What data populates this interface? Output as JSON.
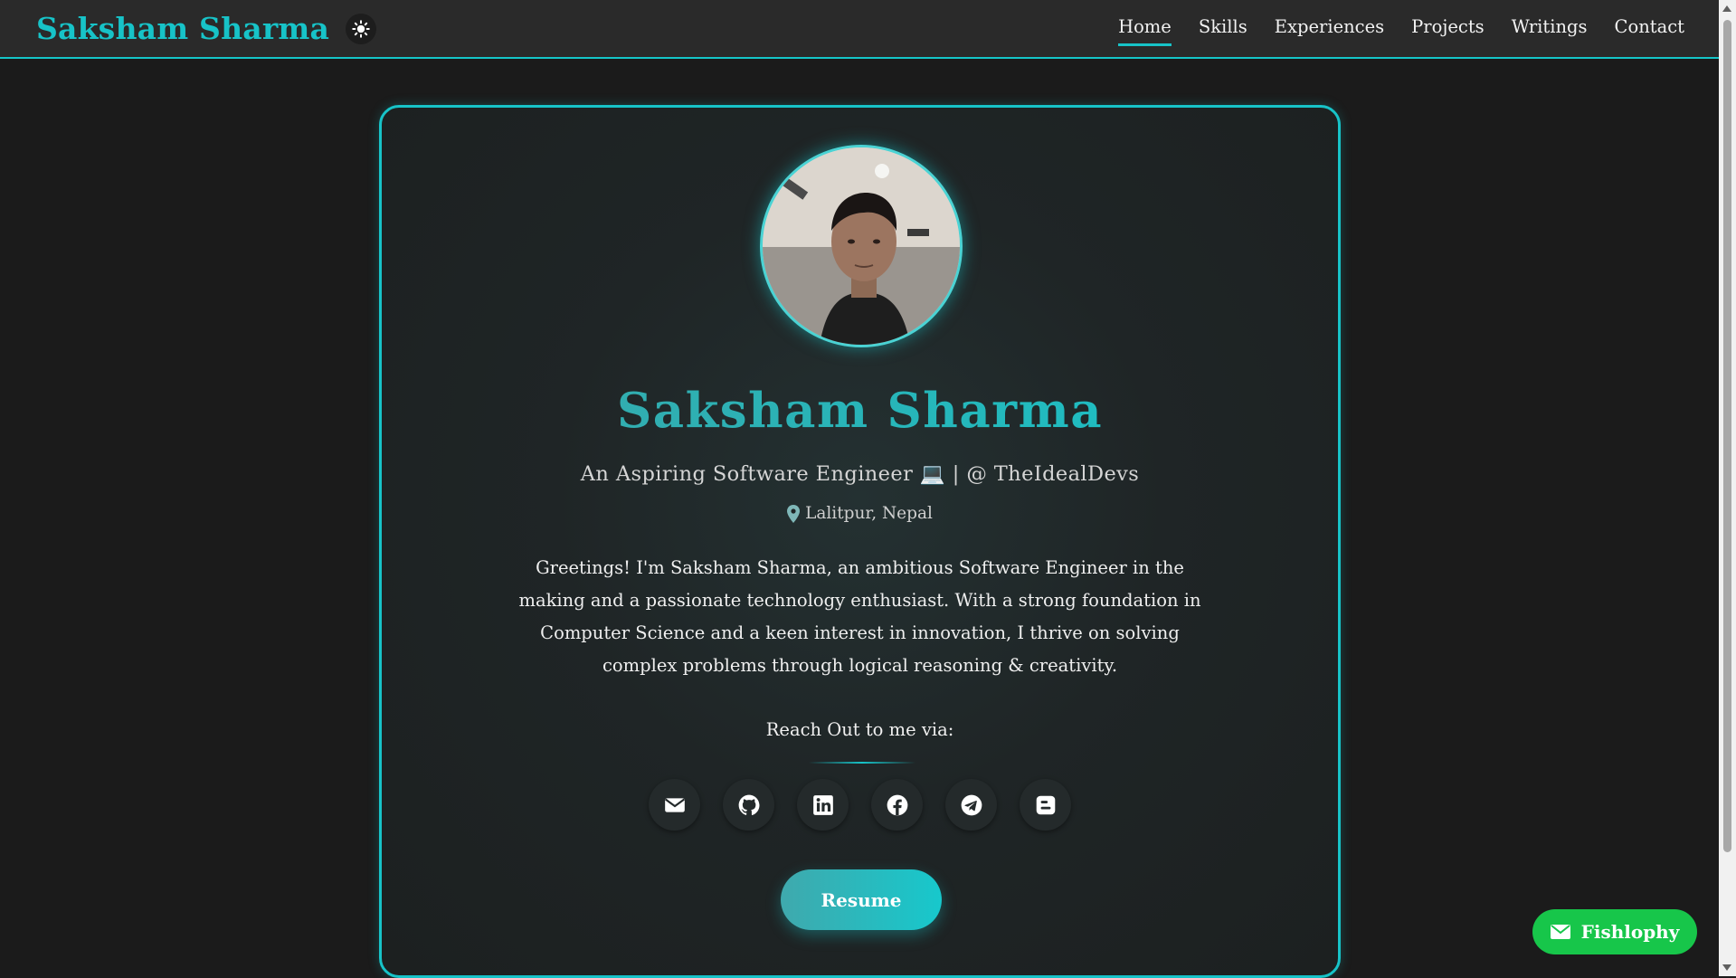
{
  "header": {
    "brand": "Saksham Sharma",
    "theme_icon": "sun-icon",
    "nav": [
      {
        "label": "Home",
        "active": true
      },
      {
        "label": "Skills",
        "active": false
      },
      {
        "label": "Experiences",
        "active": false
      },
      {
        "label": "Projects",
        "active": false
      },
      {
        "label": "Writings",
        "active": false
      },
      {
        "label": "Contact",
        "active": false
      }
    ]
  },
  "profile": {
    "name": "Saksham Sharma",
    "tagline": "An Aspiring Software Engineer 💻 | @ TheIdealDevs",
    "location": "Lalitpur, Nepal",
    "bio": "Greetings! I'm Saksham Sharma, an ambitious Software Engineer in the making and a passionate technology enthusiast. With a strong foundation in Computer Science and a keen interest in innovation, I thrive on solving complex problems through logical reasoning & creativity.",
    "reach_label": "Reach Out to me via:",
    "socials": [
      {
        "icon": "email-icon"
      },
      {
        "icon": "github-icon"
      },
      {
        "icon": "linkedin-icon"
      },
      {
        "icon": "facebook-icon"
      },
      {
        "icon": "telegram-icon"
      },
      {
        "icon": "blogger-icon"
      }
    ],
    "resume_label": "Resume"
  },
  "floating": {
    "label": "Fishlophy",
    "icon": "mail-icon"
  },
  "colors": {
    "accent": "#17c3c8",
    "background": "#1b1b1b",
    "navbar": "#2a2a2a",
    "floating_button": "#17c64a"
  }
}
